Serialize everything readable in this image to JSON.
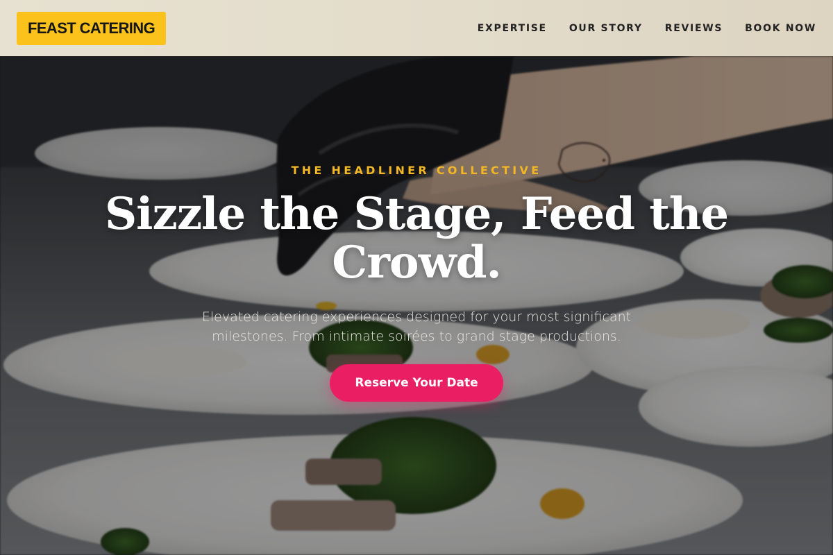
{
  "brand": {
    "logo_text": "FEAST CATERING"
  },
  "nav": {
    "items": [
      {
        "label": "EXPERTISE"
      },
      {
        "label": "OUR STORY"
      },
      {
        "label": "REVIEWS"
      },
      {
        "label": "BOOK NOW"
      }
    ]
  },
  "hero": {
    "eyebrow": "THE HEADLINER COLLECTIVE",
    "headline": "Sizzle the Stage, Feed the Crowd.",
    "subtext": "Elevated catering experiences designed for your most significant milestones. From intimate soirées to grand stage productions.",
    "cta_label": "Reserve Your Date"
  },
  "colors": {
    "brand_yellow": "#fbc21b",
    "eyebrow_gold": "#f3b724",
    "cta_pink": "#e91e63"
  }
}
